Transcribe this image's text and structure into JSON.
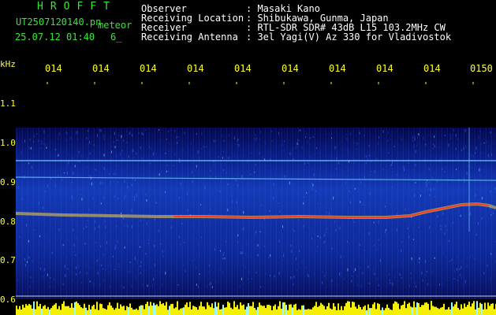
{
  "header": {
    "app_title": "HROFFT",
    "file_name": "UT2507120140.pn",
    "meteor_label": "meteor",
    "datetime": "25.07.12 01:40",
    "count": "6_",
    "rows": [
      {
        "label": "Observer",
        "value": ": Masaki Kano"
      },
      {
        "label": "Receiving Location",
        "value": ": Shibukawa, Gunma, Japan"
      },
      {
        "label": "Receiver",
        "value": ": RTL-SDR SDR# 43dB L15 103.2MHz CW"
      },
      {
        "label": "Receiving Antenna",
        "value": ": 3el Yagi(V) Az 330 for Vladivostok"
      }
    ]
  },
  "axes": {
    "y_unit": "kHz",
    "y_labels": [
      "1.1",
      "1.0",
      "0.9",
      "0.8",
      "0.7",
      "0.6"
    ],
    "x_labels": [
      "014",
      "014",
      "014",
      "014",
      "014",
      "014",
      "014",
      "014",
      "014",
      "0150"
    ]
  },
  "colors": {
    "header_green": "#36e636",
    "axis_yellow": "#ffff33",
    "spectrum_blue": "#123ab4",
    "trace_red": "#ff3b1a"
  }
}
